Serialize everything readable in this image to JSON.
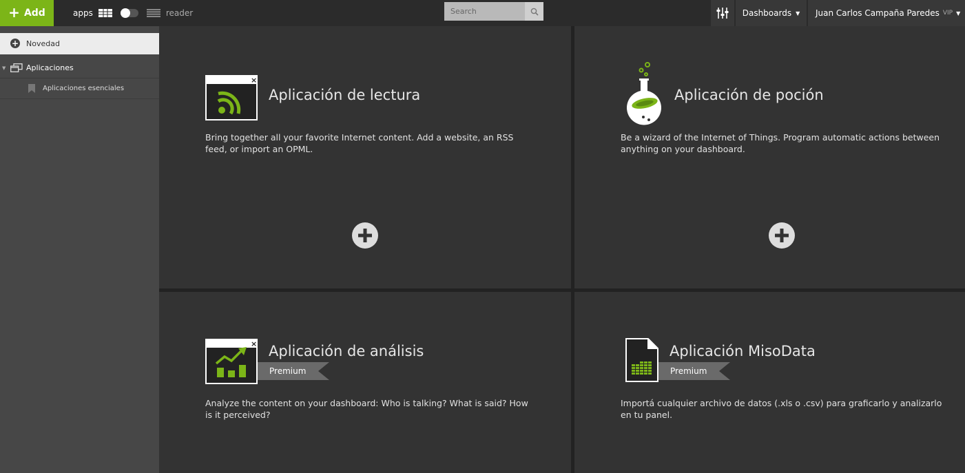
{
  "topbar": {
    "add_label": "Add",
    "view_apps_label": "apps",
    "view_reader_label": "reader",
    "search_placeholder": "Search",
    "dashboards_label": "Dashboards",
    "user_name": "Juan Carlos Campaña Paredes",
    "user_badge": "VIP"
  },
  "sidebar": {
    "novedad": "Novedad",
    "aplicaciones": "Aplicaciones",
    "sub_item": "Aplicaciones esenciales"
  },
  "cards": [
    {
      "title": "Aplicación de lectura",
      "description": "Bring together all your favorite Internet content. Add a website, an RSS feed, or import an OPML.",
      "icon": "rss-window-icon"
    },
    {
      "title": "Aplicación de poción",
      "description": "Be a wizard of the Internet of Things. Program automatic actions between anything on your dashboard.",
      "icon": "potion-flask-icon"
    },
    {
      "title": "Aplicación de análisis",
      "description": "Analyze the content on your dashboard: Who is talking? What is said? How is it perceived?",
      "badge": "Premium",
      "icon": "analytics-chart-icon"
    },
    {
      "title": "Aplicación MisoData",
      "description": "Importá cualquier archivo de datos (.xls o .csv) para graficarlo y analizarlo en tu panel.",
      "badge": "Premium",
      "icon": "data-file-icon"
    }
  ],
  "colors": {
    "accent": "#7cb518",
    "background": "#333333",
    "sidebar": "#474747",
    "topbar": "#2b2b2b"
  }
}
